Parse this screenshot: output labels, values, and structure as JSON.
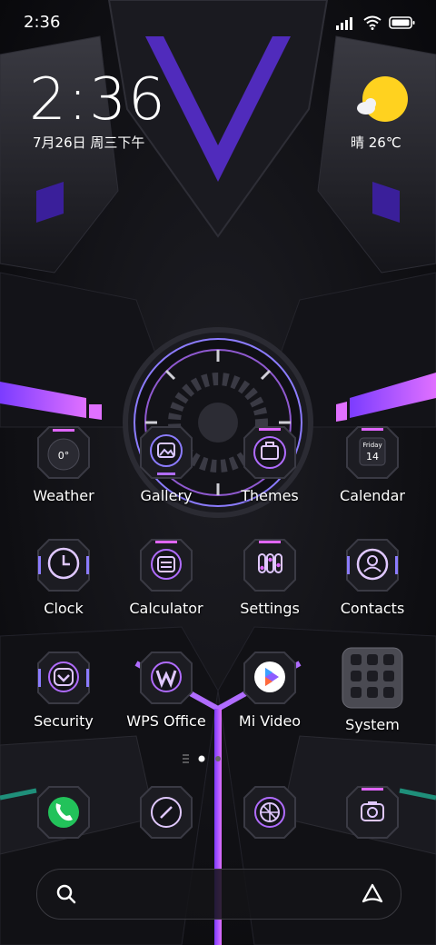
{
  "status": {
    "time": "2:36",
    "icons": [
      "signal-icon",
      "wifi-icon",
      "battery-icon"
    ]
  },
  "clock_widget": {
    "time": "2:36",
    "date": "7月26日 周三下午"
  },
  "weather_widget": {
    "icon": "sun-cloud-icon",
    "text": "晴 26℃"
  },
  "apps": [
    {
      "label": "Weather",
      "icon": "weather-icon",
      "glyph": "0°"
    },
    {
      "label": "Gallery",
      "icon": "gallery-icon"
    },
    {
      "label": "Themes",
      "icon": "themes-icon"
    },
    {
      "label": "Calendar",
      "icon": "calendar-icon",
      "day": "Friday",
      "date": "14"
    },
    {
      "label": "Clock",
      "icon": "clock-icon"
    },
    {
      "label": "Calculator",
      "icon": "calculator-icon"
    },
    {
      "label": "Settings",
      "icon": "settings-icon"
    },
    {
      "label": "Contacts",
      "icon": "contacts-icon"
    },
    {
      "label": "Security",
      "icon": "security-icon"
    },
    {
      "label": "WPS Office",
      "icon": "wps-office-icon"
    },
    {
      "label": "Mi Video",
      "icon": "mi-video-icon"
    },
    {
      "label": "System",
      "icon": "system-folder-icon"
    }
  ],
  "dock": [
    {
      "icon": "phone-icon"
    },
    {
      "icon": "notes-icon"
    },
    {
      "icon": "browser-icon"
    },
    {
      "icon": "camera-icon"
    }
  ],
  "page_indicator": {
    "pages": 2,
    "current": 1
  },
  "search_bar": {
    "left_icon": "search-icon",
    "right_icon": "assistant-icon"
  },
  "colors": {
    "accent": "#b06cff",
    "accent_pink": "#e066ff",
    "panel": "#1c1c22",
    "phone_green": "#22c25a"
  }
}
